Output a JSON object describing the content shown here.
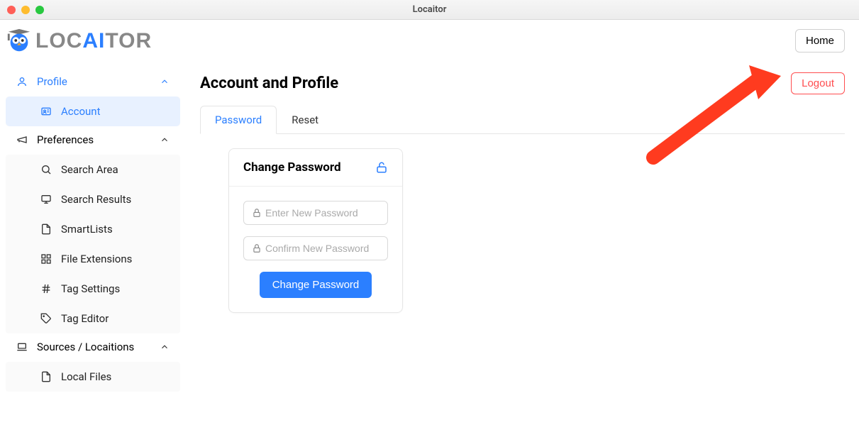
{
  "window": {
    "title": "Locaitor"
  },
  "brand": {
    "pre": "LOC",
    "mid": "AI",
    "post": "TOR"
  },
  "topbar": {
    "home": "Home"
  },
  "sidebar": {
    "profile": {
      "label": "Profile",
      "items": {
        "account": "Account"
      }
    },
    "preferences": {
      "label": "Preferences",
      "items": {
        "search_area": "Search Area",
        "search_results": "Search Results",
        "smartlists": "SmartLists",
        "file_extensions": "File Extensions",
        "tag_settings": "Tag Settings",
        "tag_editor": "Tag Editor"
      }
    },
    "sources": {
      "label": "Sources / Locaitions",
      "items": {
        "local_files": "Local Files"
      }
    }
  },
  "page": {
    "title": "Account and Profile",
    "logout": "Logout",
    "tabs": {
      "password": "Password",
      "reset": "Reset"
    },
    "card": {
      "title": "Change Password",
      "new_placeholder": "Enter New Password",
      "confirm_placeholder": "Confirm New Password",
      "submit": "Change Password"
    }
  },
  "colors": {
    "accent": "#2b7fff",
    "danger": "#ff4d4f"
  }
}
